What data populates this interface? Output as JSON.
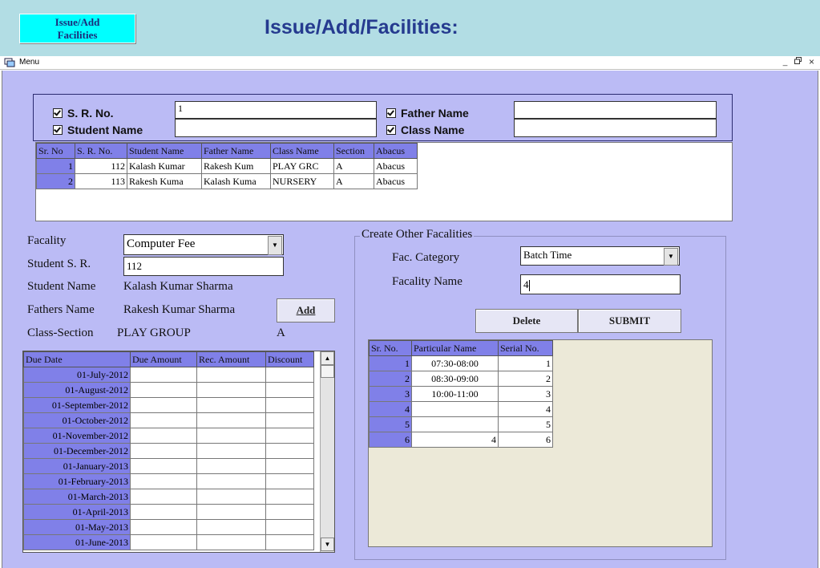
{
  "header": {
    "tab_button": "Issue/Add\nFacilities",
    "title": "Issue/Add/Facilities:"
  },
  "menubar": {
    "label": "Menu",
    "window_controls": [
      "_",
      "̅⎗",
      "×"
    ]
  },
  "search": {
    "sr_no_label": "S. R. No.",
    "sr_no_value": "1",
    "student_name_label": "Student Name",
    "student_name_value": "",
    "father_name_label": "Father Name",
    "father_name_value": "",
    "class_name_label": "Class Name",
    "class_name_value": ""
  },
  "students_table": {
    "headers": [
      "Sr. No",
      "S. R. No.",
      "Student Name",
      "Father Name",
      "Class Name",
      "Section",
      "Abacus"
    ],
    "rows": [
      [
        "1",
        "112",
        "Kalash Kumar",
        "Rakesh Kum",
        "PLAY GRC",
        "A",
        "Abacus"
      ],
      [
        "2",
        "113",
        "Rakesh Kuma",
        "Kalash Kuma",
        "NURSERY",
        "A",
        "Abacus"
      ]
    ]
  },
  "details": {
    "facality_label": "Facality",
    "facality_value": "Computer Fee",
    "student_sr_label": "Student S. R.",
    "student_sr_value": "112",
    "student_name_label": "Student Name",
    "student_name_value": "Kalash Kumar Sharma",
    "fathers_name_label": "Fathers Name",
    "fathers_name_value": "Rakesh Kumar Sharma",
    "class_section_label": "Class-Section",
    "class_value": "PLAY GROUP",
    "section_value": "A",
    "add_button": "Add"
  },
  "due_table": {
    "headers": [
      "Due Date",
      "Due Amount",
      "Rec. Amount",
      "Discount"
    ],
    "rows": [
      "01-July-2012",
      "01-August-2012",
      "01-September-2012",
      "01-October-2012",
      "01-November-2012",
      "01-December-2012",
      "01-January-2013",
      "01-February-2013",
      "01-March-2013",
      "01-April-2013",
      "01-May-2013",
      "01-June-2013"
    ]
  },
  "other_facilities": {
    "title": "Create Other Facalities",
    "category_label": "Fac. Category",
    "category_value": "Batch Time",
    "name_label": "Facality Name",
    "name_value": "4",
    "delete_button": "Delete",
    "submit_button": "SUBMIT",
    "table": {
      "headers": [
        "Sr. No.",
        "Particular  Name",
        "Serial No."
      ],
      "rows": [
        [
          "1",
          "07:30-08:00",
          "1"
        ],
        [
          "2",
          "08:30-09:00",
          "2"
        ],
        [
          "3",
          "10:00-11:00",
          "3"
        ],
        [
          "4",
          "",
          "4"
        ],
        [
          "5",
          "",
          "5"
        ],
        [
          "6",
          "4",
          "6"
        ]
      ]
    }
  }
}
